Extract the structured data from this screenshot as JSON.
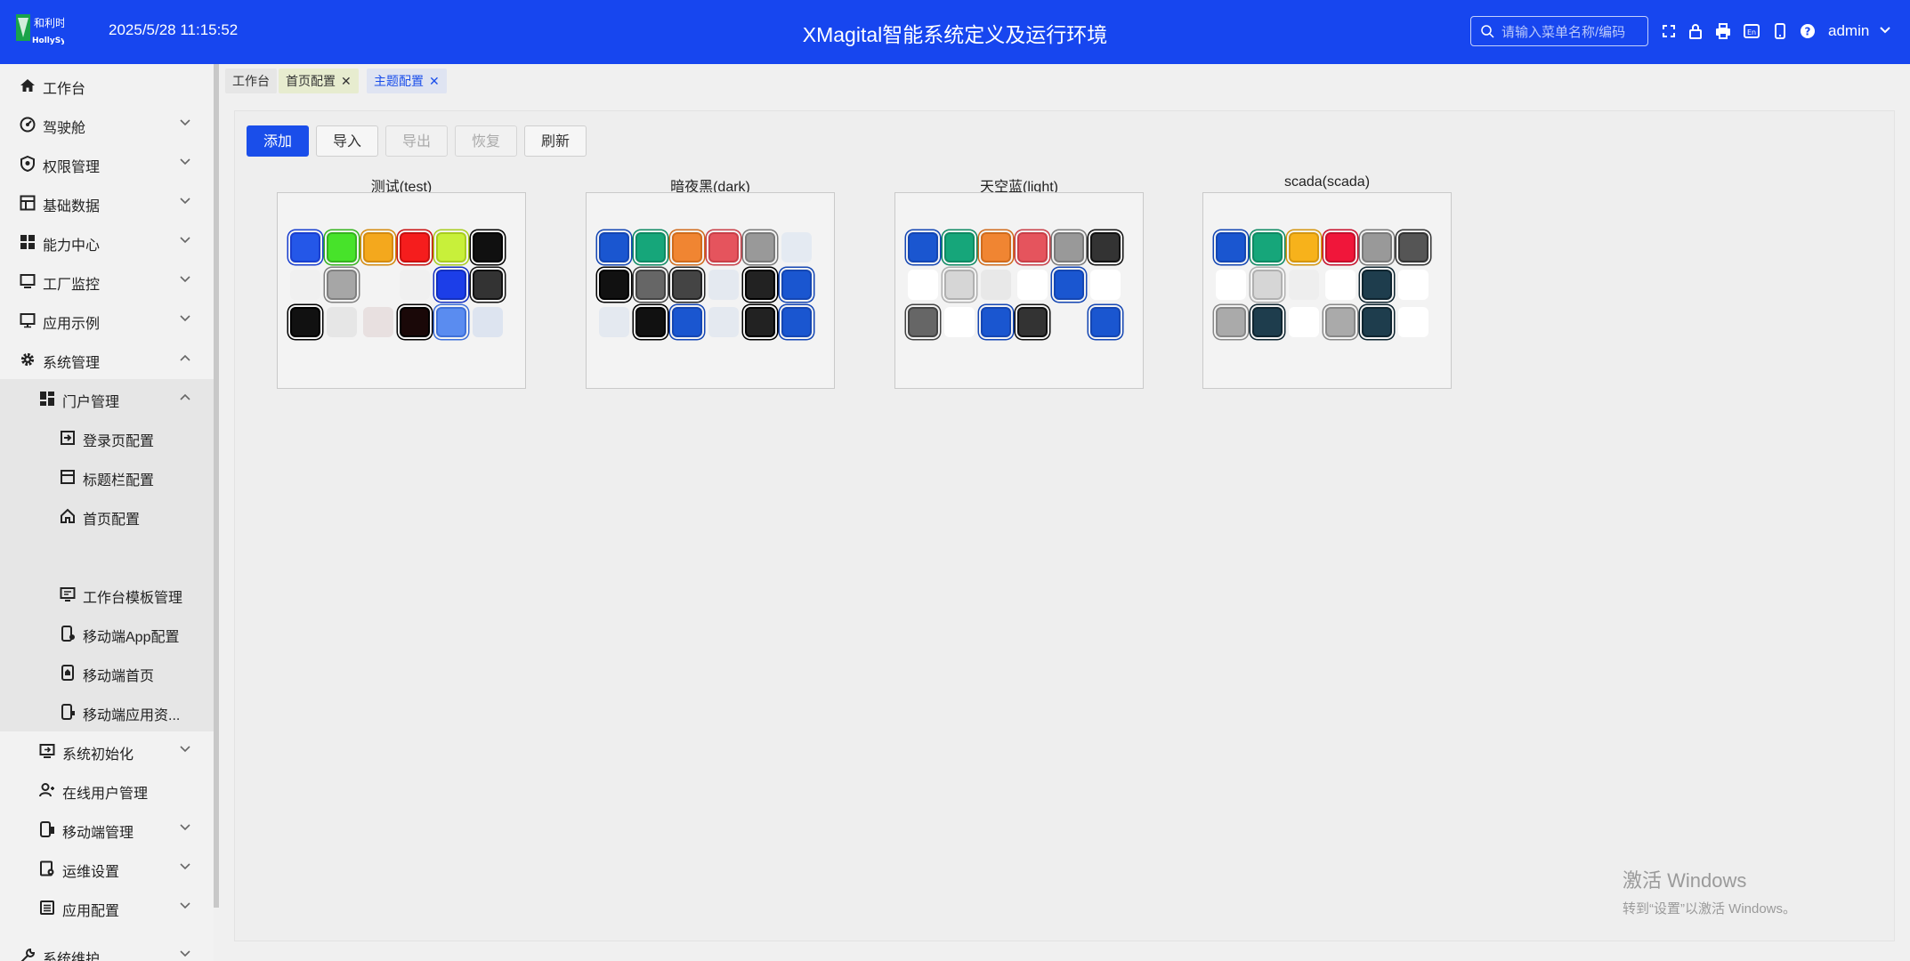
{
  "header": {
    "logo_text": "HollySys",
    "datetime": "2025/5/28 11:15:52",
    "title": "XMagital智能系统定义及运行环境",
    "search_placeholder": "请输入菜单名称/编码",
    "user": "admin",
    "icons": [
      "search-icon",
      "fullscreen-icon",
      "lock-icon",
      "print-icon",
      "language-icon",
      "mobile-icon",
      "help-icon",
      "chevron-down-icon"
    ],
    "bar_color": "#1746ef"
  },
  "sidebar": {
    "items": [
      {
        "label": "工作台",
        "icon": "home-icon"
      },
      {
        "label": "驾驶舱",
        "icon": "dashboard-icon"
      },
      {
        "label": "权限管理",
        "icon": "shield-icon"
      },
      {
        "label": "基础数据",
        "icon": "table-icon"
      },
      {
        "label": "能力中心",
        "icon": "grid-icon"
      },
      {
        "label": "工厂监控",
        "icon": "monitor-icon"
      },
      {
        "label": "应用示例",
        "icon": "screen-icon"
      },
      {
        "label": "系统管理",
        "icon": "gear-icon"
      },
      {
        "label": "门户管理",
        "icon": "portal-icon"
      },
      {
        "label": "登录页配置",
        "icon": "login-icon"
      },
      {
        "label": "标题栏配置",
        "icon": "window-icon"
      },
      {
        "label": "首页配置",
        "icon": "house-icon"
      },
      {
        "label": "",
        "icon": ""
      },
      {
        "label": "工作台模板管理",
        "icon": "template-icon"
      },
      {
        "label": "移动端App配置",
        "icon": "phone-config-icon"
      },
      {
        "label": "移动端首页",
        "icon": "phone-home-icon"
      },
      {
        "label": "移动端应用资...",
        "icon": "phone-app-icon"
      },
      {
        "label": "系统初始化",
        "icon": "init-icon"
      },
      {
        "label": "在线用户管理",
        "icon": "user-icon"
      },
      {
        "label": "移动端管理",
        "icon": "mobile-manage-icon"
      },
      {
        "label": "运维设置",
        "icon": "ops-icon"
      },
      {
        "label": "应用配置",
        "icon": "list-icon"
      },
      {
        "label": "系统维护",
        "icon": "tools-icon"
      }
    ]
  },
  "tabs": [
    {
      "label": "工作台",
      "closable": false
    },
    {
      "label": "首页配置",
      "closable": true
    },
    {
      "label": "主题配置",
      "closable": true,
      "active": true
    }
  ],
  "toolbar": {
    "add": "添加",
    "import": "导入",
    "export": "导出",
    "restore": "恢复",
    "refresh": "刷新",
    "primary_color": "#1a4eea"
  },
  "themes": [
    {
      "name": "测试(test)",
      "rows": [
        [
          [
            "#2457e8",
            "#1a3fcf"
          ],
          [
            "#47e32a",
            "#36b31f"
          ],
          [
            "#f4a81d",
            "#d48b10"
          ],
          [
            "#f51d1d",
            "#c81111"
          ],
          [
            "#c8f03a",
            "#a8cc20"
          ],
          [
            "#101010",
            "#000000"
          ]
        ],
        [
          [
            "#f0f0f0",
            "#f0f0f0"
          ],
          [
            "#a6a6a6",
            "#808080"
          ],
          [
            "#f3f3f3",
            "#f3f3f3"
          ],
          [
            "#f0f0f0",
            "#f0f0f0"
          ],
          [
            "#1c3ee8",
            "#1430c0"
          ],
          [
            "#333333",
            "#111111"
          ]
        ],
        [
          [
            "#111111",
            "#000000"
          ],
          [
            "#e6e6e6",
            "#e6e6e6"
          ],
          [
            "#e8e0e0",
            "#e8e0e0"
          ],
          [
            "#1a0808",
            "#000000"
          ],
          [
            "#5a8cf0",
            "#3f70d8"
          ],
          [
            "#dde4f0",
            "#dde4f0"
          ]
        ]
      ]
    },
    {
      "name": "暗夜黑(dark)",
      "rows": [
        [
          [
            "#1a56d0",
            "#1446b3"
          ],
          [
            "#16a67a",
            "#0e8a63"
          ],
          [
            "#f08532",
            "#d06b1c"
          ],
          [
            "#e5545d",
            "#c83f48"
          ],
          [
            "#999999",
            "#7a7a7a"
          ],
          [
            "#e4eaf2",
            "#e4eaf2"
          ]
        ],
        [
          [
            "#111111",
            "#000000"
          ],
          [
            "#666666",
            "#444444"
          ],
          [
            "#444444",
            "#222222"
          ],
          [
            "#e4e9f0",
            "#e4e9f0"
          ],
          [
            "#222222",
            "#000000"
          ],
          [
            "#1a56d0",
            "#1446b3"
          ]
        ],
        [
          [
            "#e4e9f0",
            "#e4e9f0"
          ],
          [
            "#111111",
            "#000000"
          ],
          [
            "#1a56d0",
            "#1446b3"
          ],
          [
            "#e4e9f0",
            "#e4e9f0"
          ],
          [
            "#222222",
            "#000000"
          ],
          [
            "#1a56d0",
            "#1446b3"
          ]
        ]
      ]
    },
    {
      "name": "天空蓝(light)",
      "rows": [
        [
          [
            "#1a56d0",
            "#1446b3"
          ],
          [
            "#16a67a",
            "#0e8a63"
          ],
          [
            "#f08532",
            "#d06b1c"
          ],
          [
            "#e5545d",
            "#c83f48"
          ],
          [
            "#999999",
            "#7a7a7a"
          ],
          [
            "#333333",
            "#111111"
          ]
        ],
        [
          [
            "#ffffff",
            "#ffffff"
          ],
          [
            "#d6d6d6",
            "#b0b0b0"
          ],
          [
            "#e8e8e8",
            "#e8e8e8"
          ],
          [
            "#ffffff",
            "#ffffff"
          ],
          [
            "#1a56d0",
            "#1446b3"
          ],
          [
            "#ffffff",
            "#ffffff"
          ]
        ],
        [
          [
            "#666666",
            "#444444"
          ],
          [
            "#ffffff",
            "#ffffff"
          ],
          [
            "#1a56d0",
            "#1446b3"
          ],
          [
            "#333333",
            "#111111"
          ],
          [
            "#f3f3f3",
            "#f3f3f3"
          ],
          [
            "#1a56d0",
            "#1446b3"
          ]
        ]
      ]
    },
    {
      "name": "scada(scada)",
      "rows": [
        [
          [
            "#1a56d0",
            "#1446b3"
          ],
          [
            "#16a67a",
            "#0e8a63"
          ],
          [
            "#f7b21b",
            "#d49610"
          ],
          [
            "#f0163a",
            "#c60f2b"
          ],
          [
            "#999999",
            "#7a7a7a"
          ],
          [
            "#555555",
            "#333333"
          ]
        ],
        [
          [
            "#ffffff",
            "#ffffff"
          ],
          [
            "#d6d6d6",
            "#b0b0b0"
          ],
          [
            "#eeeeee",
            "#eeeeee"
          ],
          [
            "#ffffff",
            "#ffffff"
          ],
          [
            "#1e3d4d",
            "#0f2530"
          ],
          [
            "#ffffff",
            "#ffffff"
          ]
        ],
        [
          [
            "#aaaaaa",
            "#888888"
          ],
          [
            "#1e3d4d",
            "#0f2530"
          ],
          [
            "#ffffff",
            "#ffffff"
          ],
          [
            "#aaaaaa",
            "#888888"
          ],
          [
            "#1e3d4d",
            "#0f2530"
          ],
          [
            "#ffffff",
            "#ffffff"
          ]
        ]
      ]
    }
  ],
  "watermark": {
    "line1": "激活 Windows",
    "line2": "转到“设置”以激活 Windows。"
  }
}
